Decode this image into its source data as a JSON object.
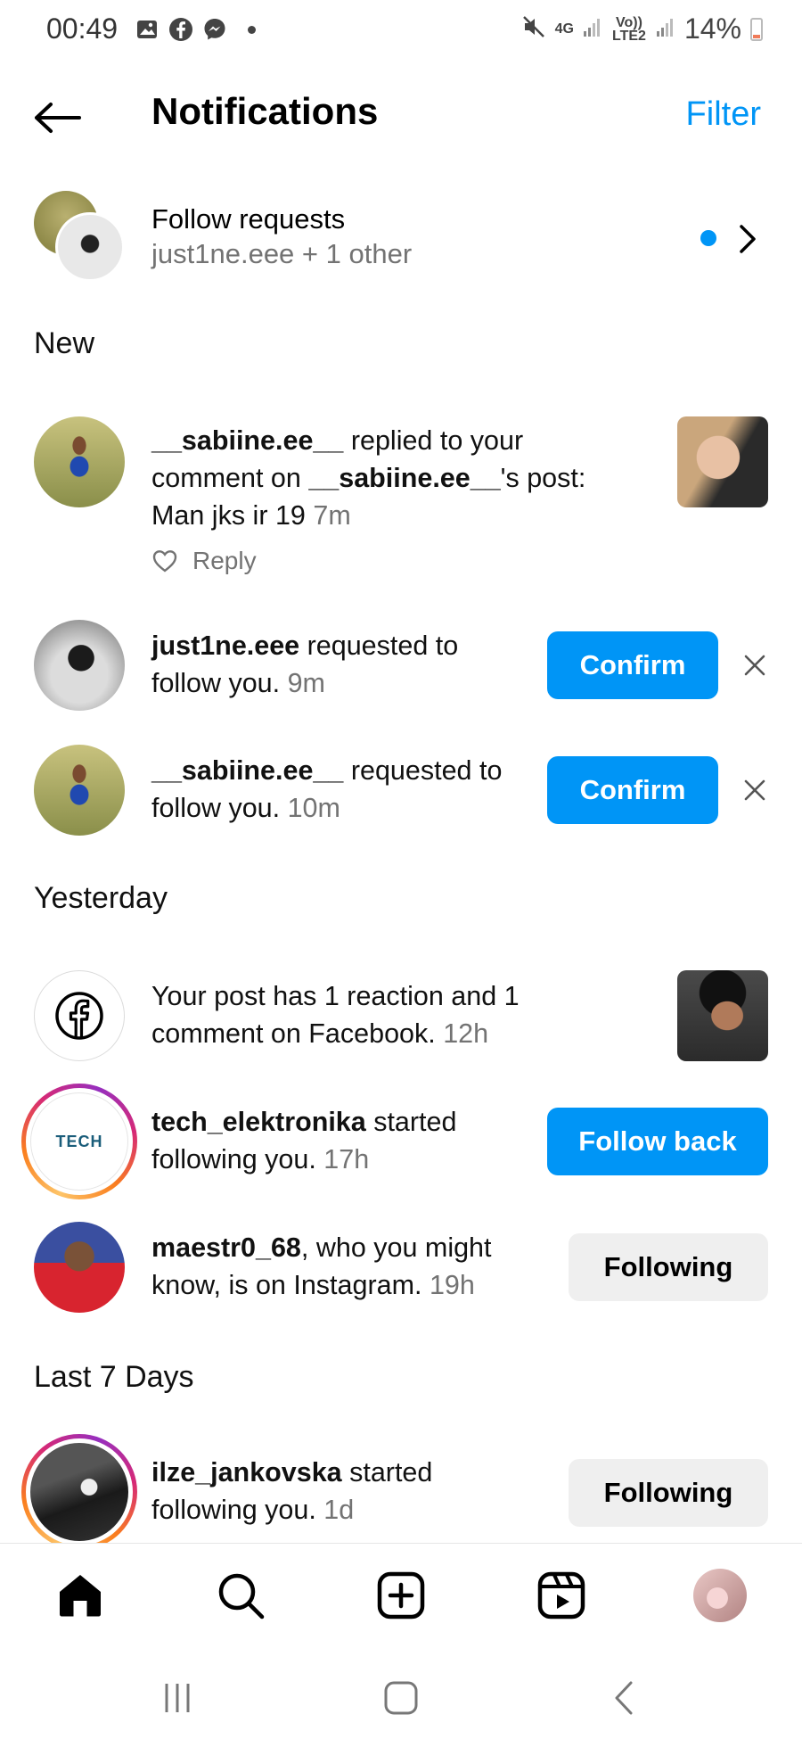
{
  "status_bar": {
    "time": "00:49",
    "net_4g": "4G",
    "net_volte": "Vo)) LTE2",
    "battery": "14%"
  },
  "header": {
    "title": "Notifications",
    "filter_label": "Filter"
  },
  "follow_requests": {
    "title": "Follow requests",
    "subtitle": "just1ne.eee + 1 other"
  },
  "sections": {
    "new": "New",
    "yesterday": "Yesterday",
    "last7": "Last 7 Days"
  },
  "notifications": [
    {
      "user": "__sabiine.ee__",
      "text_mid": " replied to your comment on ",
      "user2": "__sabiine.ee__",
      "text_end": "'s post: Man jks ir 19 ",
      "time": "7m",
      "reply_label": "Reply"
    },
    {
      "user": "just1ne.eee",
      "text": " requested to follow you. ",
      "time": "9m",
      "button": "Confirm"
    },
    {
      "user": "__sabiine.ee__",
      "text": " requested to follow you. ",
      "time": "10m",
      "button": "Confirm"
    },
    {
      "text": "Your post has 1 reaction and 1 comment on Facebook. ",
      "time": "12h"
    },
    {
      "user": "tech_elektronika",
      "text": " started following you. ",
      "time": "17h",
      "button": "Follow back",
      "avatar_label": "TECH"
    },
    {
      "user": "maestr0_68",
      "text": ", who you might know, is on Instagram. ",
      "time": "19h",
      "button": "Following"
    },
    {
      "user": "ilze_jankovska",
      "text": " started following you. ",
      "time": "1d",
      "button": "Following"
    }
  ],
  "colors": {
    "accent": "#0095f6",
    "muted_text": "#737373",
    "secondary_button": "#efefef"
  },
  "icons": {
    "back": "arrow-left-icon",
    "chevron": "chevron-right-icon",
    "close": "close-icon",
    "heart": "heart-icon",
    "facebook": "facebook-icon",
    "home": "home-icon",
    "search": "search-icon",
    "create": "create-icon",
    "reels": "reels-icon"
  }
}
